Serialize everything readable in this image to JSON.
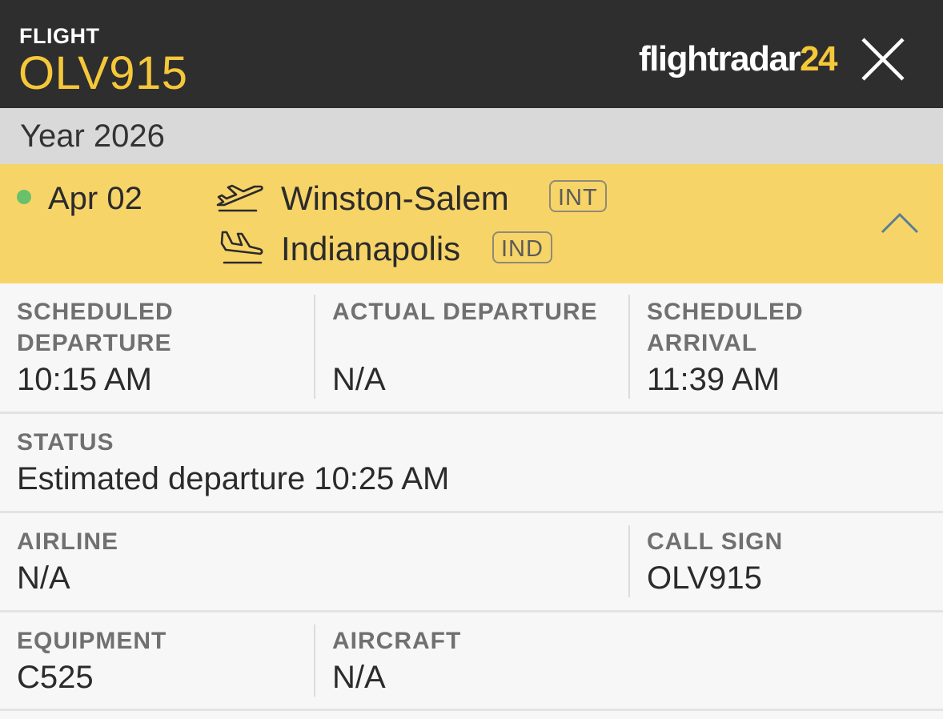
{
  "header": {
    "flight_label": "FLIGHT",
    "flight_number": "OLV915",
    "logo_text_white": "flightradar",
    "logo_text_yellow": "24",
    "close_icon": "close-icon",
    "colors": {
      "background": "#2e2e2e",
      "accent": "#f5c83a"
    }
  },
  "year_bar": {
    "text": "Year 2026"
  },
  "flight_row": {
    "status_dot_color": "#69c16b",
    "date": "Apr 02",
    "origin": {
      "city": "Winston-Salem",
      "code": "INT",
      "icon": "takeoff-icon"
    },
    "destination": {
      "city": "Indianapolis",
      "code": "IND",
      "icon": "landing-icon"
    },
    "toggle_icon": "chevron-up-icon",
    "background": "#f7d468"
  },
  "details": {
    "scheduled_departure": {
      "label_line1": "SCHEDULED",
      "label_line2": "DEPARTURE",
      "value": "10:15 AM"
    },
    "actual_departure": {
      "label": "ACTUAL DEPARTURE",
      "value": "N/A"
    },
    "scheduled_arrival": {
      "label_line1": "SCHEDULED",
      "label_line2": "ARRIVAL",
      "value": "11:39 AM"
    },
    "status": {
      "label": "STATUS",
      "value": "Estimated departure 10:25 AM"
    },
    "airline": {
      "label": "AIRLINE",
      "value": "N/A"
    },
    "call_sign": {
      "label": "CALL SIGN",
      "value": "OLV915"
    },
    "equipment": {
      "label": "EQUIPMENT",
      "value": "C525"
    },
    "aircraft": {
      "label": "AIRCRAFT",
      "value": "N/A"
    }
  }
}
